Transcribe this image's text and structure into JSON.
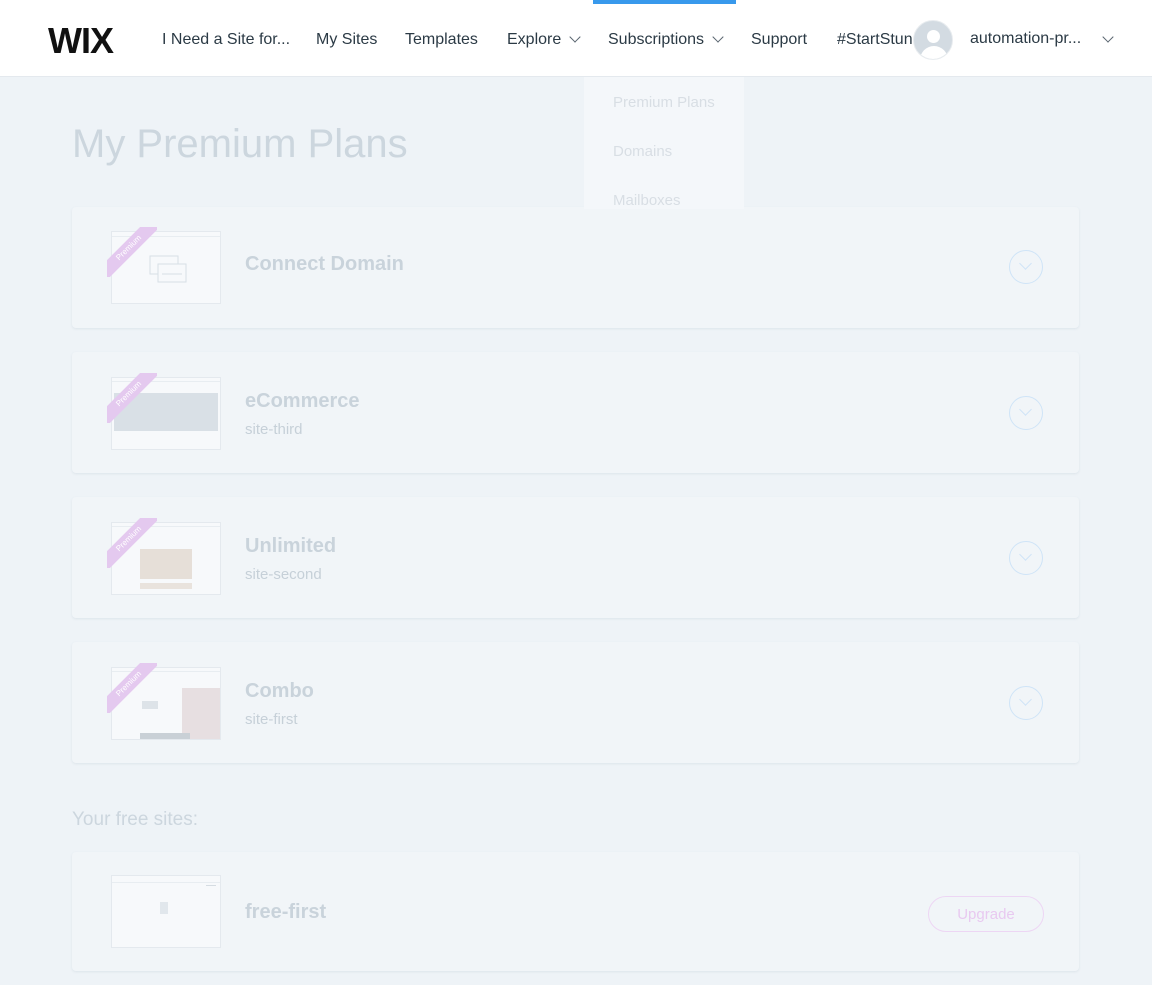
{
  "header": {
    "logo_text": "WIX",
    "nav": [
      "I Need a Site for...",
      "My Sites",
      "Templates",
      "Explore",
      "Subscriptions",
      "Support",
      "#StartStunning"
    ],
    "user_name": "automation-pr...",
    "active_tab": "Subscriptions"
  },
  "dropdown": {
    "items": [
      "Premium Plans",
      "Domains",
      "Mailboxes"
    ]
  },
  "page": {
    "title": "My Premium Plans",
    "ribbon_label": "Premium",
    "plans": [
      {
        "name": "Connect Domain",
        "site": ""
      },
      {
        "name": "eCommerce",
        "site": "site-third"
      },
      {
        "name": "Unlimited",
        "site": "site-second"
      },
      {
        "name": "Combo",
        "site": "site-first"
      }
    ],
    "free_title": "Your free sites:",
    "free_sites": [
      {
        "name": "free-first",
        "action": "Upgrade"
      }
    ]
  },
  "colors": {
    "accent": "#3899ec",
    "ribbon": "#e4c9ef",
    "upgrade_border": "#edd6f4"
  }
}
